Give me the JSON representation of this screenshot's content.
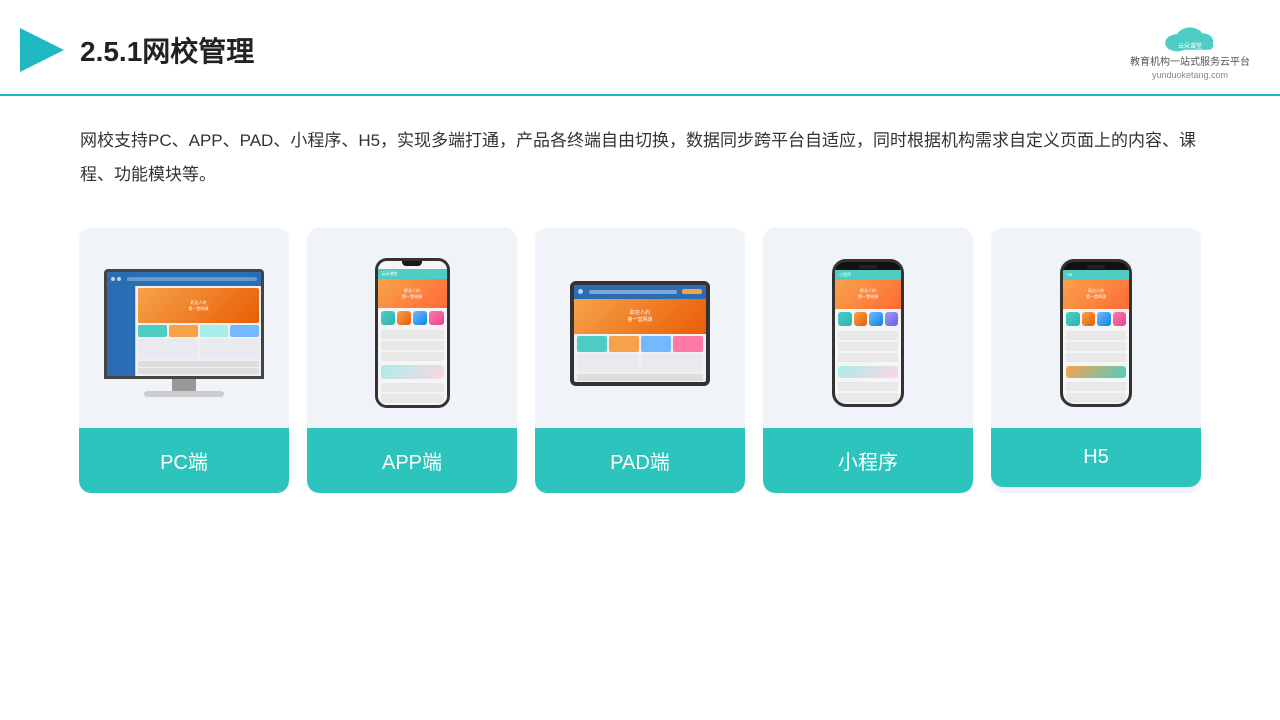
{
  "header": {
    "title": "2.5.1网校管理",
    "logo_name": "云朵课堂",
    "logo_subtitle": "教育机构一站\n式服务云平台",
    "logo_url": "yunduoketang.com"
  },
  "description": {
    "text": "网校支持PC、APP、PAD、小程序、H5，实现多端打通，产品各终端自由切换，数据同步跨平台自适应，同时根据机构需求自定义页面上的内容、课程、功能模块等。"
  },
  "cards": [
    {
      "id": "pc",
      "label": "PC端"
    },
    {
      "id": "app",
      "label": "APP端"
    },
    {
      "id": "pad",
      "label": "PAD端"
    },
    {
      "id": "mini",
      "label": "小程序"
    },
    {
      "id": "h5",
      "label": "H5"
    }
  ],
  "colors": {
    "accent": "#2cc4bc",
    "accent_dark": "#1fb8c3",
    "text_primary": "#333",
    "orange": "#f7a24b",
    "blue": "#2a6db5"
  }
}
